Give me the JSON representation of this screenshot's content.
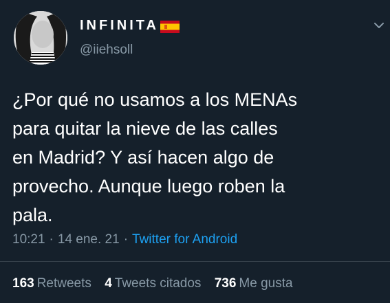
{
  "user": {
    "display_name": "INFINITA",
    "handle": "@iiehsoll",
    "flag_icon": "spain-flag-icon"
  },
  "tweet": {
    "lines": [
      "¿Por qué no usamos a los MENAs",
      "para quitar la nieve de las calles",
      "en Madrid? Y así hacen algo de",
      "provecho. Aunque luego roben la",
      "pala."
    ],
    "time": "10:21",
    "date": "14 ene. 21",
    "separator": "·",
    "source": "Twitter for Android"
  },
  "stats": {
    "retweets_count": "163",
    "retweets_label": "Retweets",
    "quotes_count": "4",
    "quotes_label": "Tweets citados",
    "likes_count": "736",
    "likes_label": "Me gusta"
  },
  "colors": {
    "background": "#15202b",
    "text": "#ffffff",
    "secondary": "#8899a6",
    "link": "#1da1f2"
  }
}
